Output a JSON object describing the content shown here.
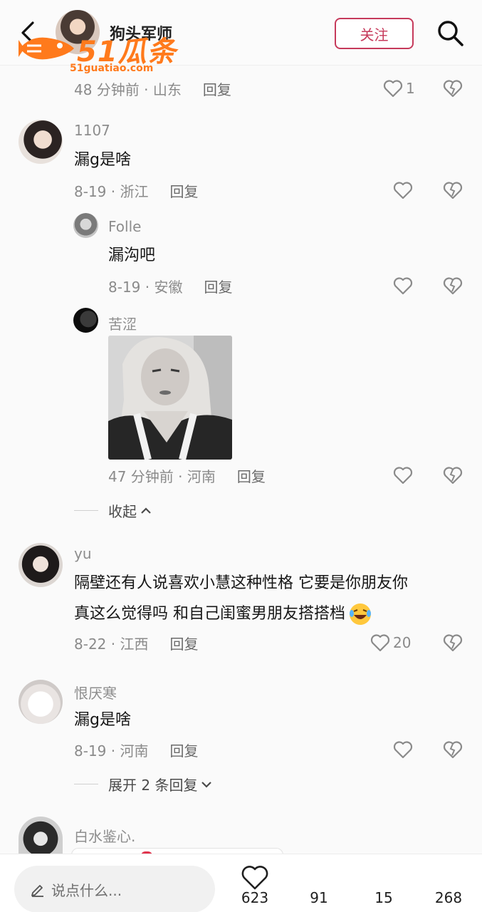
{
  "header": {
    "author": "狗头军师",
    "follow_label": "关注",
    "watermark_main": "51瓜条",
    "watermark_sub": "51guatiao.com"
  },
  "first_meta": {
    "time_location": "48 分钟前 · 山东",
    "reply": "回复",
    "likes": "1"
  },
  "comments": [
    {
      "user": "1107",
      "text": "漏g是啥",
      "meta": "8-19 · 浙江",
      "reply": "回复",
      "replies": [
        {
          "user": "Folle",
          "text": "漏沟吧",
          "meta": "8-19 · 安徽",
          "reply": "回复"
        },
        {
          "user": "苦涩",
          "meta": "47 分钟前 · 河南",
          "reply": "回复"
        }
      ],
      "collapse_label": "收起"
    },
    {
      "user": "yu",
      "text_line1": "隔壁还有人说喜欢小慧这种性格 它要是你朋友你",
      "text_line2": "真这么觉得吗 和自己闺蜜男朋友搭搭档",
      "meta": "8-22 · 江西",
      "reply": "回复",
      "likes": "20"
    },
    {
      "user": "恨厌寒",
      "text": "漏g是啥",
      "meta": "8-19 · 河南",
      "reply": "回复",
      "expand_label": "展开 2 条回复"
    },
    {
      "user": "白水鉴心."
    }
  ],
  "bottom": {
    "input_placeholder": "说点什么...",
    "likes": "623",
    "stat2": "91",
    "stat3": "15",
    "stat4": "268"
  },
  "colors": {
    "accent": "#c63a5b",
    "watermark": "#ff7a1c",
    "text": "#161616",
    "muted": "#8a8a8a"
  },
  "icons": [
    "back-arrow-icon",
    "search-icon",
    "heart-icon",
    "broken-heart-icon",
    "chevron-up-icon",
    "chevron-down-icon",
    "pen-icon",
    "laughing-emoji-icon"
  ]
}
